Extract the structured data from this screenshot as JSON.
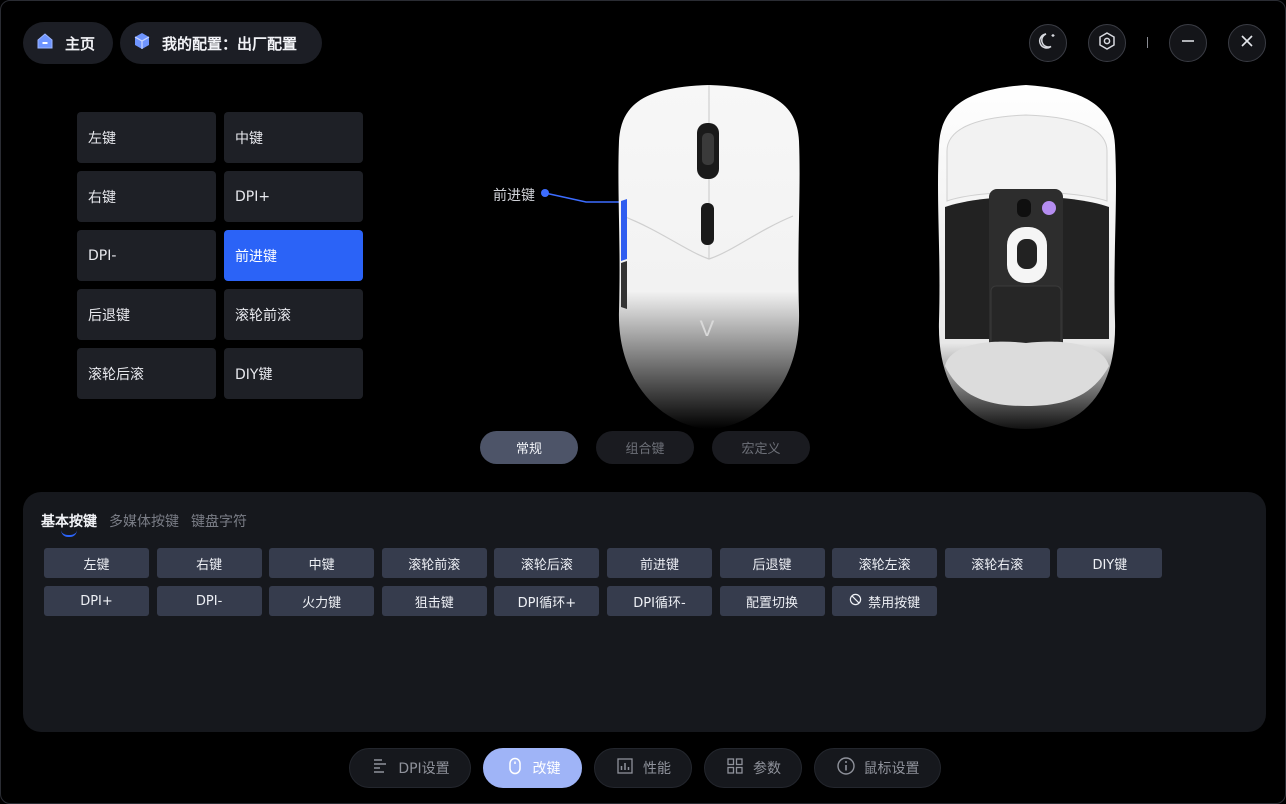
{
  "header": {
    "home_label": "主页",
    "profile_label": "我的配置：出厂配置"
  },
  "key_grid": [
    {
      "label": "左键",
      "active": false
    },
    {
      "label": "中键",
      "active": false
    },
    {
      "label": "右键",
      "active": false
    },
    {
      "label": "DPI+",
      "active": false
    },
    {
      "label": "DPI-",
      "active": false
    },
    {
      "label": "前进键",
      "active": true
    },
    {
      "label": "后退键",
      "active": false
    },
    {
      "label": "滚轮前滚",
      "active": false
    },
    {
      "label": "滚轮后滚",
      "active": false
    },
    {
      "label": "DIY键",
      "active": false
    }
  ],
  "callout_label": "前进键",
  "mode_tabs": [
    "常规",
    "组合键",
    "宏定义"
  ],
  "sub_tabs": [
    "基本按键",
    "多媒体按键",
    "键盘字符"
  ],
  "function_buttons": [
    "左键",
    "右键",
    "中键",
    "滚轮前滚",
    "滚轮后滚",
    "前进键",
    "后退键",
    "滚轮左滚",
    "滚轮右滚",
    "DIY键",
    "DPI+",
    "DPI-",
    "火力键",
    "狙击键",
    "DPI循环+",
    "DPI循环-",
    "配置切换",
    "禁用按键"
  ],
  "bottom_nav": [
    {
      "label": "DPI设置",
      "icon": "dpi-settings-icon",
      "active": false
    },
    {
      "label": "改键",
      "icon": "mouse-icon",
      "active": true
    },
    {
      "label": "性能",
      "icon": "performance-chart-icon",
      "active": false
    },
    {
      "label": "参数",
      "icon": "params-grid-icon",
      "active": false
    },
    {
      "label": "鼠标设置",
      "icon": "info-icon",
      "active": false
    }
  ],
  "colors": {
    "accent": "#2b63f7",
    "active_nav": "#9fb4f7",
    "active_mode_tab": "#4d5468",
    "function_button": "#363c4d"
  }
}
